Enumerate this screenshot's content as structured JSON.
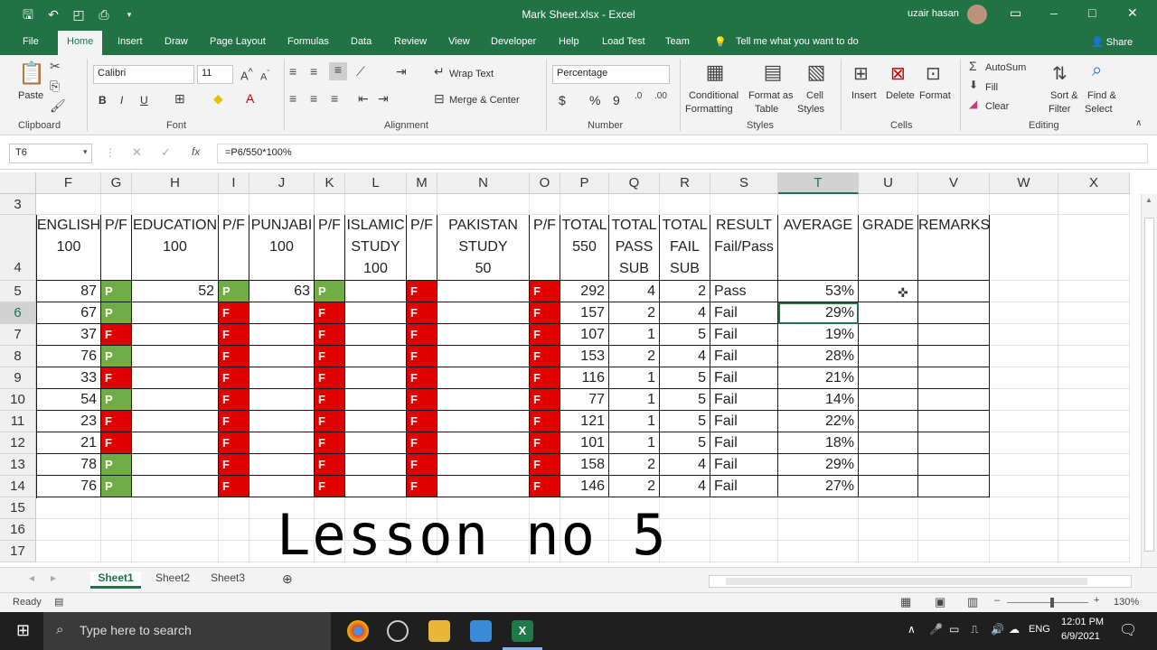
{
  "titlebar": {
    "title": "Mark Sheet.xlsx  -  Excel",
    "user": "uzair hasan",
    "qat": [
      "save-icon",
      "undo-icon",
      "touch-mode-icon",
      "print-preview-icon"
    ],
    "minimize": "–",
    "restore": "□",
    "close": "✕",
    "ribbon_display": "▭"
  },
  "tabs": [
    "File",
    "Home",
    "Insert",
    "Draw",
    "Page Layout",
    "Formulas",
    "Data",
    "Review",
    "View",
    "Developer",
    "Help",
    "Load Test",
    "Team"
  ],
  "tell_me": "Tell me what you want to do",
  "share": "Share",
  "ribbon": {
    "clipboard": {
      "label": "Clipboard",
      "paste": "Paste"
    },
    "font": {
      "label": "Font",
      "name": "Calibri",
      "size": "11",
      "bold": "B",
      "italic": "I",
      "underline": "U"
    },
    "alignment": {
      "label": "Alignment",
      "wrap": "Wrap Text",
      "merge": "Merge & Center"
    },
    "number": {
      "label": "Number",
      "format": "Percentage",
      "currency": "$",
      "percent": "%",
      "comma": "9"
    },
    "styles": {
      "label": "Styles",
      "cond": "Conditional",
      "cond2": "Formatting",
      "fmt_table": "Format as",
      "fmt_table2": "Table",
      "cell_styles": "Cell",
      "cell_styles2": "Styles"
    },
    "cells": {
      "label": "Cells",
      "insert": "Insert",
      "delete": "Delete",
      "format": "Format"
    },
    "editing": {
      "label": "Editing",
      "autosum": "AutoSum",
      "fill": "Fill",
      "clear": "Clear",
      "sort": "Sort &",
      "sort2": "Filter",
      "find": "Find &",
      "find2": "Select"
    }
  },
  "formula_bar": {
    "name_box": "T6",
    "formula": "=P6/550*100%",
    "fx": "fx"
  },
  "columns": [
    "F",
    "G",
    "H",
    "I",
    "J",
    "K",
    "L",
    "M",
    "N",
    "O",
    "P",
    "Q",
    "R",
    "S",
    "T",
    "U",
    "V",
    "W",
    "X"
  ],
  "row_numbers": [
    "3",
    "4",
    "5",
    "6",
    "7",
    "8",
    "9",
    "10",
    "11",
    "12",
    "13",
    "14",
    "15",
    "16",
    "17"
  ],
  "headers": {
    "english": "ENGLISH",
    "english_max": "100",
    "pf": "P/F",
    "education": "EDUCATION",
    "education_max": "100",
    "punjabi": "PUNJABI",
    "punjabi_max": "100",
    "islamic": "ISLAMIC",
    "islamic2": "STUDY",
    "islamic_max": "100",
    "pakistan": "PAKISTAN",
    "pakistan2": "STUDY",
    "pakistan_max": "50",
    "total": "TOTAL",
    "total_max": "550",
    "total_pass": "TOTAL",
    "total_pass2": "PASS",
    "total_pass3": "SUB",
    "total_fail": "TOTAL",
    "total_fail2": "FAIL",
    "total_fail3": "SUB",
    "result": "RESULT",
    "result2": "Fail/Pass",
    "average": "AVERAGE",
    "grade": "GRADE",
    "remarks": "REMARKS"
  },
  "rows": [
    {
      "english": "87",
      "g": "P",
      "education": "52",
      "i": "P",
      "punjabi": "63",
      "k": "P",
      "m": "F",
      "o": "F",
      "total": "292",
      "pass": "4",
      "fail": "2",
      "result": "Pass",
      "average": "53%"
    },
    {
      "english": "67",
      "g": "P",
      "education": "",
      "i": "F",
      "punjabi": "",
      "k": "F",
      "m": "F",
      "o": "F",
      "total": "157",
      "pass": "2",
      "fail": "4",
      "result": "Fail",
      "average": "29%"
    },
    {
      "english": "37",
      "g": "F",
      "education": "",
      "i": "F",
      "punjabi": "",
      "k": "F",
      "m": "F",
      "o": "F",
      "total": "107",
      "pass": "1",
      "fail": "5",
      "result": "Fail",
      "average": "19%"
    },
    {
      "english": "76",
      "g": "P",
      "education": "",
      "i": "F",
      "punjabi": "",
      "k": "F",
      "m": "F",
      "o": "F",
      "total": "153",
      "pass": "2",
      "fail": "4",
      "result": "Fail",
      "average": "28%"
    },
    {
      "english": "33",
      "g": "F",
      "education": "",
      "i": "F",
      "punjabi": "",
      "k": "F",
      "m": "F",
      "o": "F",
      "total": "116",
      "pass": "1",
      "fail": "5",
      "result": "Fail",
      "average": "21%"
    },
    {
      "english": "54",
      "g": "P",
      "education": "",
      "i": "F",
      "punjabi": "",
      "k": "F",
      "m": "F",
      "o": "F",
      "total": "77",
      "pass": "1",
      "fail": "5",
      "result": "Fail",
      "average": "14%"
    },
    {
      "english": "23",
      "g": "F",
      "education": "",
      "i": "F",
      "punjabi": "",
      "k": "F",
      "m": "F",
      "o": "F",
      "total": "121",
      "pass": "1",
      "fail": "5",
      "result": "Fail",
      "average": "22%"
    },
    {
      "english": "21",
      "g": "F",
      "education": "",
      "i": "F",
      "punjabi": "",
      "k": "F",
      "m": "F",
      "o": "F",
      "total": "101",
      "pass": "1",
      "fail": "5",
      "result": "Fail",
      "average": "18%"
    },
    {
      "english": "78",
      "g": "P",
      "education": "",
      "i": "F",
      "punjabi": "",
      "k": "F",
      "m": "F",
      "o": "F",
      "total": "158",
      "pass": "2",
      "fail": "4",
      "result": "Fail",
      "average": "29%"
    },
    {
      "english": "76",
      "g": "P",
      "education": "",
      "i": "F",
      "punjabi": "",
      "k": "F",
      "m": "F",
      "o": "F",
      "total": "146",
      "pass": "2",
      "fail": "4",
      "result": "Fail",
      "average": "27%"
    }
  ],
  "overlay_text": "Lesson no 5",
  "sheet_tabs": [
    "Sheet1",
    "Sheet2",
    "Sheet3"
  ],
  "status": {
    "ready": "Ready",
    "zoom": "130%"
  },
  "taskbar": {
    "search": "Type here to search",
    "lang": "ENG",
    "time": "12:01 PM",
    "date": "6/9/2021"
  },
  "colors": {
    "excel_green": "#217346",
    "pass_green": "#70ad47",
    "fail_red": "#e00000"
  }
}
